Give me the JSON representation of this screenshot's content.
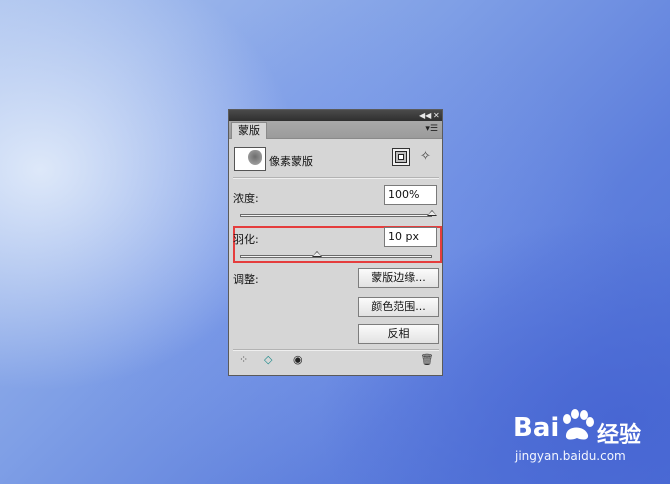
{
  "panel": {
    "tab_label": "蒙版",
    "mask_title": "像素蒙版",
    "density": {
      "label": "浓度:",
      "value": "100%",
      "slider_percent": 100
    },
    "feather": {
      "label": "羽化:",
      "value": "10 px",
      "slider_percent": 40
    },
    "adjust": {
      "label": "调整:",
      "buttons": [
        "蒙版边缘...",
        "颜色范围...",
        "反相"
      ]
    },
    "icons": {
      "collapse": "double-arrow-left-icon",
      "close": "close-icon",
      "menu": "panel-menu-icon",
      "pixel_mask": "pixel-mask-icon",
      "vector_mask": "vector-mask-icon",
      "load_selection": "load-selection-icon",
      "apply_mask": "apply-mask-icon",
      "visibility": "eye-icon",
      "delete": "trash-icon"
    },
    "highlight_color": "#e53d3d"
  },
  "watermark": {
    "logo_left": "Bai",
    "logo_right": "经验",
    "url": "jingyan.baidu.com"
  }
}
